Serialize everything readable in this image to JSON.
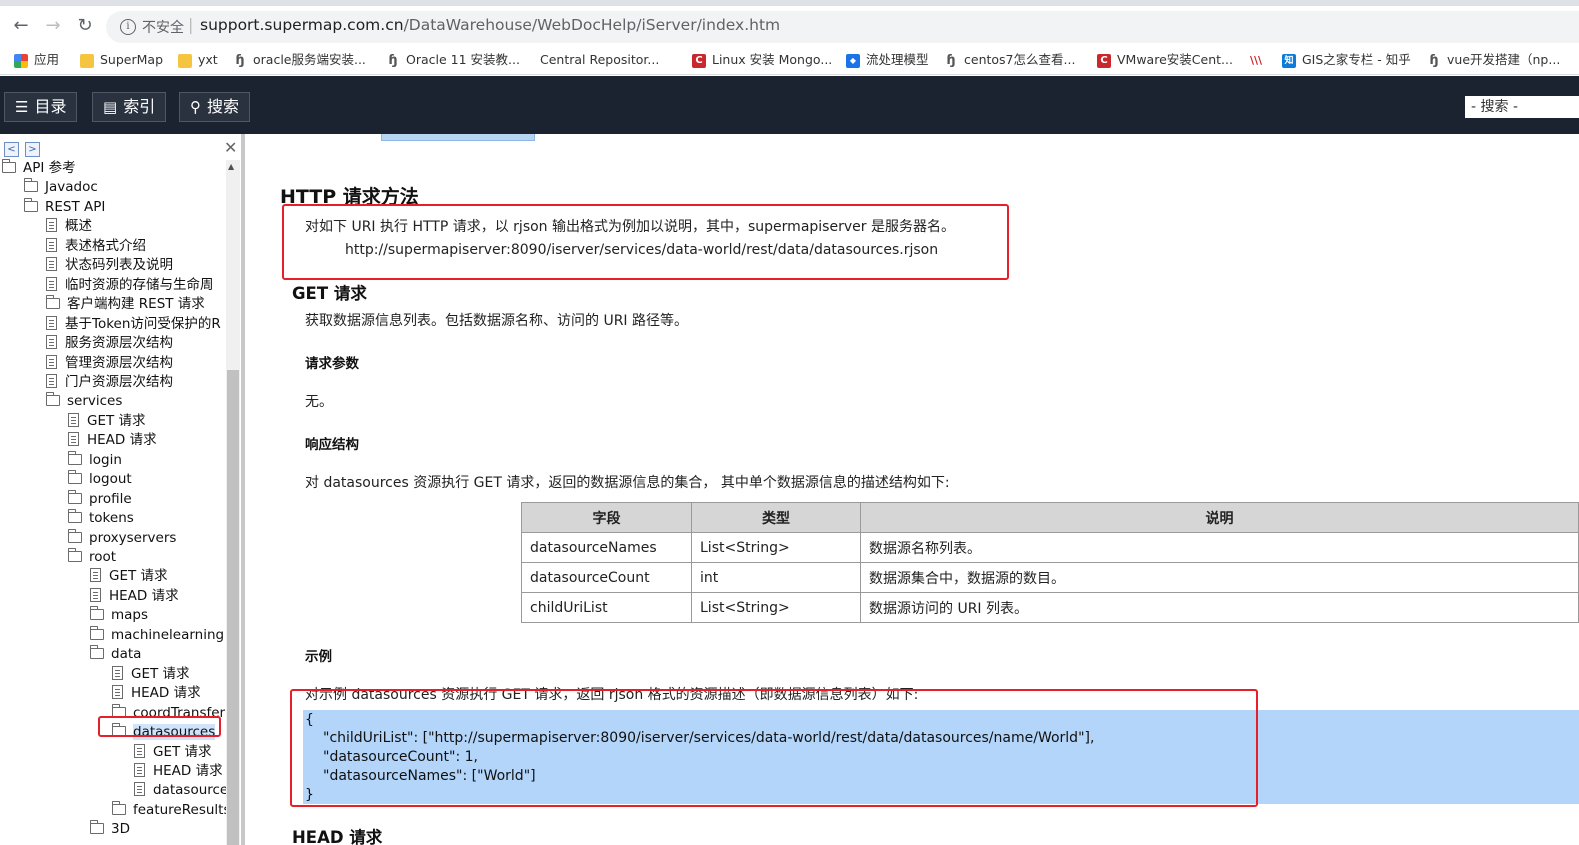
{
  "browser": {
    "insecure_label": "不安全",
    "url_host": "support.supermap.com.cn",
    "url_path": "/DataWarehouse/WebDocHelp/iServer/index.htm",
    "bookmarks": [
      {
        "label": "应用",
        "icon": "apps-grid-icon"
      },
      {
        "label": "SuperMap",
        "icon": "folder-icon"
      },
      {
        "label": "yxt",
        "icon": "folder-icon"
      },
      {
        "label": "oracle服务端安装...",
        "icon": "jenkins-icon"
      },
      {
        "label": "Oracle 11 安装教...",
        "icon": "jenkins-icon"
      },
      {
        "label": "Central Repositor...",
        "icon": "blank-icon"
      },
      {
        "label": "Linux 安装 Mongo...",
        "icon": "csdn-icon"
      },
      {
        "label": "流处理模型",
        "icon": "blue-app-icon"
      },
      {
        "label": "centos7怎么查看...",
        "icon": "jenkins-icon"
      },
      {
        "label": "VMware安装Cent...",
        "icon": "csdn-icon"
      },
      {
        "label": "",
        "icon": "stripes-icon"
      },
      {
        "label": "GIS之家专栏 - 知乎",
        "icon": "zhihu-icon"
      },
      {
        "label": "vue开发搭建（np...",
        "icon": "jenkins-icon"
      }
    ],
    "colors": {
      "csdn": "#c9282d",
      "zhihu": "#0e7bd8",
      "folder": "#f5c542",
      "blue_app": "#1a73e8"
    }
  },
  "help_toolbar": {
    "toc_label": "目录",
    "index_label": "索引",
    "search_label": "搜索",
    "search_placeholder": "- 搜索 -"
  },
  "tree": {
    "nodes": [
      {
        "label": "API 参考",
        "type": "folder",
        "level": 0
      },
      {
        "label": "Javadoc",
        "type": "folder",
        "level": 1
      },
      {
        "label": "REST API",
        "type": "folder",
        "level": 1
      },
      {
        "label": "概述",
        "type": "doc",
        "level": 2
      },
      {
        "label": "表述格式介绍",
        "type": "doc",
        "level": 2
      },
      {
        "label": "状态码列表及说明",
        "type": "doc",
        "level": 2
      },
      {
        "label": "临时资源的存储与生命周",
        "type": "doc",
        "level": 2
      },
      {
        "label": "客户端构建 REST 请求",
        "type": "folder",
        "level": 2
      },
      {
        "label": "基于Token访问受保护的R",
        "type": "doc",
        "level": 2
      },
      {
        "label": "服务资源层次结构",
        "type": "doc",
        "level": 2
      },
      {
        "label": "管理资源层次结构",
        "type": "doc",
        "level": 2
      },
      {
        "label": "门户资源层次结构",
        "type": "doc",
        "level": 2
      },
      {
        "label": "services",
        "type": "folder",
        "level": 2
      },
      {
        "label": "GET 请求",
        "type": "doc",
        "level": 3
      },
      {
        "label": "HEAD 请求",
        "type": "doc",
        "level": 3
      },
      {
        "label": "login",
        "type": "folder",
        "level": 3
      },
      {
        "label": "logout",
        "type": "folder",
        "level": 3
      },
      {
        "label": "profile",
        "type": "folder",
        "level": 3
      },
      {
        "label": "tokens",
        "type": "folder",
        "level": 3
      },
      {
        "label": "proxyservers",
        "type": "folder",
        "level": 3
      },
      {
        "label": "root",
        "type": "folder",
        "level": 3
      },
      {
        "label": "GET 请求",
        "type": "doc",
        "level": 4
      },
      {
        "label": "HEAD 请求",
        "type": "doc",
        "level": 4
      },
      {
        "label": "maps",
        "type": "folder",
        "level": 4
      },
      {
        "label": "machinelearning",
        "type": "folder",
        "level": 4
      },
      {
        "label": "data",
        "type": "folder",
        "level": 4
      },
      {
        "label": "GET 请求",
        "type": "doc",
        "level": 5
      },
      {
        "label": "HEAD 请求",
        "type": "doc",
        "level": 5
      },
      {
        "label": "coordTransfer",
        "type": "folder",
        "level": 5
      },
      {
        "label": "datasources",
        "type": "folder",
        "level": 5,
        "selected": true
      },
      {
        "label": "GET 请求",
        "type": "doc",
        "level": 6
      },
      {
        "label": "HEAD 请求",
        "type": "doc",
        "level": 6
      },
      {
        "label": "datasource",
        "type": "doc",
        "level": 6
      },
      {
        "label": "featureResults",
        "type": "folder",
        "level": 5
      },
      {
        "label": "3D",
        "type": "folder",
        "level": 4
      }
    ]
  },
  "content": {
    "section_title": "HTTP 请求方法",
    "intro_text": "对如下 URI 执行 HTTP 请求，以 rjson 输出格式为例加以说明，其中，supermapiserver 是服务器名。",
    "example_uri": "http://supermapiserver:8090/iserver/services/data-world/rest/data/datasources.rjson",
    "get_title": "GET 请求",
    "get_desc": "获取数据源信息列表。包括数据源名称、访问的 URI 路径等。",
    "params_title": "请求参数",
    "params_value": "无。",
    "response_title": "响应结构",
    "response_desc": "对 datasources 资源执行 GET 请求，返回的数据源信息的集合， 其中单个数据源信息的描述结构如下:",
    "table": {
      "headers": [
        "字段",
        "类型",
        "说明"
      ],
      "rows": [
        [
          "datasourceNames",
          "List<String>",
          "数据源名称列表。"
        ],
        [
          "datasourceCount",
          "int",
          "数据源集合中，数据源的数目。"
        ],
        [
          "childUriList",
          "List<String>",
          "数据源访问的 URI 列表。"
        ]
      ]
    },
    "example_title": "示例",
    "example_desc": "对示例 datasources 资源执行 GET 请求，返回 rjson 格式的资源描述（即数据源信息列表）如下:",
    "code_lines": [
      "{",
      "\"childUriList\": [\"http://supermapiserver:8090/iserver/services/data-world/rest/data/datasources/name/World\"],",
      "\"datasourceCount\": 1,",
      "\"datasourceNames\": [\"World\"]",
      "}"
    ],
    "head_title": "HEAD 请求"
  }
}
